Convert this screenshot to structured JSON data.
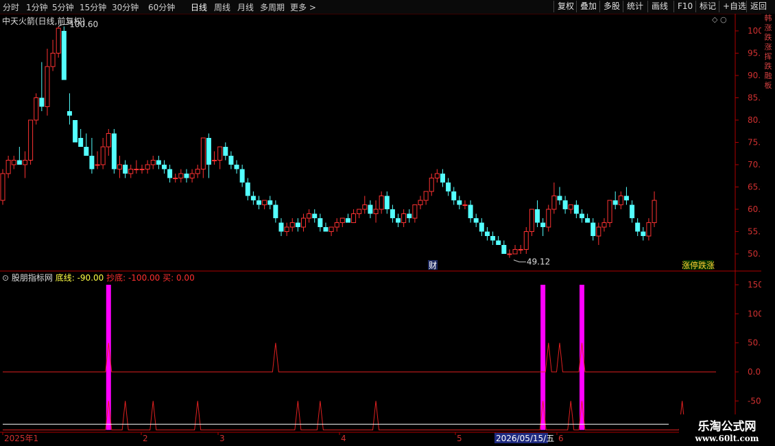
{
  "toolbar": {
    "periods": [
      "分时",
      "1分钟",
      "5分钟",
      "15分钟",
      "30分钟",
      "60分钟",
      "日线",
      "周线",
      "月线",
      "多周期",
      "更多 >"
    ],
    "active": "日线",
    "right_buttons": [
      "复权",
      "叠加",
      "多股",
      "统计",
      "画线",
      "F10",
      "标记",
      "+自选",
      "返回"
    ]
  },
  "price_panel": {
    "title": "中天火箭(日线,前复权)",
    "high_label": "100.60",
    "low_label": "49.12",
    "event_tag": "财",
    "badge": "涨停跌涨"
  },
  "indicator_panel": {
    "name": "股朋指标网",
    "line1": "底线: -90.00",
    "line2": "抄底: -100.00",
    "line3": "买: 0.00"
  },
  "side_text": "韩涨跌涨挥跌融板",
  "watermark": {
    "line1": "乐淘公式网",
    "line2": "www.60lt.com"
  },
  "colors": {
    "up": "#ff3232",
    "down": "#54ffff",
    "signal": "#ff00ff",
    "axis": "#b00000",
    "line": "#e02020"
  },
  "chart_data": [
    {
      "type": "candlestick",
      "title": "中天火箭(日线,前复权)",
      "y_ticks": [
        100,
        95,
        90,
        85,
        80,
        75,
        70,
        65,
        60,
        55,
        50
      ],
      "ylim": [
        47.5,
        102
      ],
      "x_ticks": [
        "2025年1",
        "2",
        "3",
        "4",
        "5",
        "2026/05/15/五",
        "6"
      ],
      "annotations": [
        {
          "text": "100.60",
          "type": "high"
        },
        {
          "text": "49.12",
          "type": "low"
        },
        {
          "text": "财",
          "type": "event"
        }
      ],
      "ohlc": [
        [
          62,
          69,
          61,
          68
        ],
        [
          68,
          72,
          67,
          71
        ],
        [
          70,
          72,
          69,
          71
        ],
        [
          71,
          74,
          70,
          70
        ],
        [
          70,
          73,
          67,
          71
        ],
        [
          71,
          80,
          70,
          80
        ],
        [
          80,
          86,
          79,
          85
        ],
        [
          85,
          93,
          82,
          83
        ],
        [
          83,
          96,
          81,
          92
        ],
        [
          92,
          98,
          91,
          95
        ],
        [
          95,
          101,
          94,
          100.6
        ],
        [
          100,
          101,
          89,
          89
        ],
        [
          82,
          86,
          79,
          81
        ],
        [
          80,
          80,
          75,
          75
        ],
        [
          76,
          78,
          74,
          74
        ],
        [
          74,
          77,
          72,
          72
        ],
        [
          72,
          76,
          68,
          69
        ],
        [
          70,
          73,
          69,
          70
        ],
        [
          70,
          76,
          69,
          74
        ],
        [
          74,
          78,
          72,
          77
        ],
        [
          77,
          78,
          68,
          69
        ],
        [
          69,
          72,
          67,
          70
        ],
        [
          70,
          71,
          67,
          68
        ],
        [
          68,
          70,
          67,
          69
        ],
        [
          69,
          71,
          68,
          69
        ],
        [
          69,
          70,
          68,
          69
        ],
        [
          69,
          71,
          68,
          70
        ],
        [
          70,
          72,
          69,
          71
        ],
        [
          71,
          72,
          69,
          70
        ],
        [
          70,
          71,
          68,
          69
        ],
        [
          69,
          70,
          66,
          67
        ],
        [
          67,
          68,
          66,
          67
        ],
        [
          67,
          69,
          66,
          68
        ],
        [
          68,
          69,
          66,
          67
        ],
        [
          67,
          69,
          66,
          68
        ],
        [
          68,
          70,
          67,
          69
        ],
        [
          69,
          76,
          67,
          76
        ],
        [
          76,
          77,
          67,
          70
        ],
        [
          71,
          73,
          70,
          71
        ],
        [
          71,
          74,
          69,
          74
        ],
        [
          74,
          75,
          71,
          72
        ],
        [
          72,
          73,
          69,
          70
        ],
        [
          70,
          71,
          68,
          69
        ],
        [
          69,
          70,
          65,
          66
        ],
        [
          66,
          67,
          62,
          63
        ],
        [
          63,
          64,
          61,
          62
        ],
        [
          62,
          63,
          60,
          61
        ],
        [
          61,
          62,
          60,
          62
        ],
        [
          62,
          63,
          60,
          61
        ],
        [
          61,
          62,
          57,
          58
        ],
        [
          57,
          58,
          54,
          55
        ],
        [
          55,
          57,
          54,
          56
        ],
        [
          56,
          58,
          55,
          57
        ],
        [
          57,
          58,
          55,
          56
        ],
        [
          56,
          59,
          55,
          58
        ],
        [
          58,
          60,
          57,
          59
        ],
        [
          59,
          60,
          57,
          58
        ],
        [
          58,
          59,
          55,
          56
        ],
        [
          56,
          57,
          55,
          55
        ],
        [
          55,
          56,
          54,
          56
        ],
        [
          56,
          58,
          55,
          57
        ],
        [
          57,
          58,
          56,
          58
        ],
        [
          58,
          59,
          57,
          57
        ],
        [
          57,
          60,
          57,
          59
        ],
        [
          59,
          60,
          58,
          60
        ],
        [
          60,
          63,
          59,
          61
        ],
        [
          61,
          62,
          58,
          59
        ],
        [
          59,
          62,
          57,
          60
        ],
        [
          60,
          64,
          59,
          63
        ],
        [
          63,
          64,
          59,
          60
        ],
        [
          60,
          61,
          57,
          58
        ],
        [
          58,
          59,
          56,
          57
        ],
        [
          57,
          60,
          56,
          59
        ],
        [
          59,
          60,
          57,
          58
        ],
        [
          58,
          61,
          57,
          61
        ],
        [
          61,
          63,
          60,
          62
        ],
        [
          62,
          64,
          61,
          64
        ],
        [
          64,
          68,
          63,
          67
        ],
        [
          67,
          69,
          66,
          68
        ],
        [
          68,
          69,
          65,
          66
        ],
        [
          66,
          67,
          63,
          64
        ],
        [
          64,
          65,
          61,
          62
        ],
        [
          62,
          63,
          60,
          61
        ],
        [
          61,
          62,
          60,
          61
        ],
        [
          61,
          62,
          57,
          58
        ],
        [
          58,
          59,
          56,
          57
        ],
        [
          57,
          58,
          54,
          55
        ],
        [
          55,
          56,
          53,
          54
        ],
        [
          54,
          55,
          52,
          53
        ],
        [
          53,
          54,
          52,
          52
        ],
        [
          52,
          53,
          50,
          50
        ],
        [
          50,
          51,
          49.12,
          50
        ],
        [
          50,
          52,
          50,
          51
        ],
        [
          51,
          52,
          50,
          51
        ],
        [
          51,
          56,
          50,
          55
        ],
        [
          55,
          60,
          54,
          60
        ],
        [
          60,
          62,
          56,
          57
        ],
        [
          57,
          58,
          54,
          56
        ],
        [
          56,
          61,
          55,
          60
        ],
        [
          60,
          66,
          59,
          63
        ],
        [
          63,
          65,
          61,
          62
        ],
        [
          62,
          63,
          59,
          60
        ],
        [
          60,
          61,
          59,
          61
        ],
        [
          61,
          62,
          58,
          59
        ],
        [
          59,
          60,
          57,
          58
        ],
        [
          58,
          59,
          57,
          57
        ],
        [
          57,
          58,
          53,
          54
        ],
        [
          54,
          57,
          52,
          56
        ],
        [
          56,
          58,
          55,
          57
        ],
        [
          57,
          62,
          56,
          62
        ],
        [
          62,
          64,
          60,
          61
        ],
        [
          61,
          64,
          60,
          63
        ],
        [
          63,
          65,
          61,
          62
        ],
        [
          61,
          62,
          57,
          58
        ],
        [
          57,
          58,
          54,
          55
        ],
        [
          55,
          56,
          53,
          54
        ],
        [
          54,
          58,
          53,
          57
        ],
        [
          57,
          64,
          56,
          62
        ]
      ]
    },
    {
      "type": "line",
      "title": "股朋指标网",
      "y_ticks": [
        150,
        100,
        50,
        0,
        -50
      ],
      "ylim": [
        -100,
        160
      ],
      "series": [
        {
          "name": "底线",
          "value": -90
        },
        {
          "name": "抄底",
          "value": -100
        },
        {
          "name": "买",
          "value": 0
        }
      ],
      "buy_spikes": [
        0,
        0,
        0,
        0,
        0,
        0,
        0,
        0,
        0,
        0,
        0,
        0,
        0,
        0,
        0,
        0,
        0,
        0,
        0,
        0,
        0,
        0,
        0,
        0,
        0,
        0,
        0,
        0,
        0,
        0,
        0,
        0,
        0,
        0,
        0,
        0,
        0,
        0,
        0,
        0,
        0,
        0,
        0,
        0,
        0,
        0,
        0,
        0,
        0,
        0,
        0,
        0,
        0,
        0,
        0,
        0,
        0,
        0,
        0,
        0,
        0,
        0,
        0,
        0,
        0,
        0,
        0,
        0,
        0,
        0,
        0,
        0,
        0,
        0,
        0,
        0,
        0,
        0,
        0,
        0,
        0,
        0,
        0,
        0,
        0,
        0,
        0,
        0,
        0,
        0,
        0,
        0,
        0,
        0,
        0,
        0,
        0,
        0,
        0,
        0,
        0,
        0,
        0,
        0,
        0,
        0,
        0,
        0,
        0,
        0,
        0,
        0,
        0,
        0,
        0,
        0
      ],
      "buy_spike_days": [
        19,
        49,
        98,
        100,
        104
      ],
      "bottom_spike_days": [
        19,
        22,
        27,
        35,
        53,
        57,
        67,
        97,
        102,
        104,
        122
      ],
      "signal_bar_days": [
        19,
        97,
        104
      ],
      "signal_bar_value": 150
    }
  ]
}
